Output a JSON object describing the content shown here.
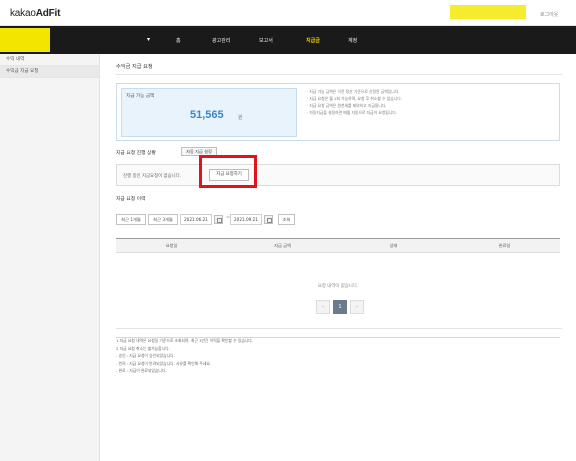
{
  "header": {
    "brand_prefix": "kakao",
    "brand_main": "AdFit",
    "user_label": "로그아웃"
  },
  "nav": {
    "dropdown_icon": "caret-down-icon",
    "items": [
      "홈",
      "광고관리",
      "보고서",
      "지급금",
      "계정"
    ],
    "active_index": 3
  },
  "sidebar": {
    "items": [
      "수익 내역",
      "수익금 지급 요청"
    ]
  },
  "page": {
    "title": "수익금 지급 요청",
    "balance_label": "지급 가능 금액",
    "balance_value": "51,565",
    "balance_unit": "원",
    "notices": [
      "· 지급 가능 금액은 이전 정산 기준으로 산정된 금액입니다.",
      "· 지급 요청은 월 1회 가능하며, 요청 후 취소할 수 없습니다.",
      "· 지급 요청 금액은 원천세를 제외하고 지급됩니다.",
      "· 자동지급을 설정하면 매월 자동으로 지급이 요청됩니다."
    ],
    "status_title": "지급 요청 진행 상황",
    "auto_button": "자동 지급 설정",
    "status_text": "진행 중인 지급요청이 없습니다.",
    "request_button": "지급 요청하기",
    "history_title": "지급 요청 이력",
    "filter_buttons": [
      "최근 1개월",
      "최근 3개월"
    ],
    "date_from": "2021.06.21",
    "date_to": "2021.09.21",
    "date_separator": "~",
    "search_button": "조회",
    "table_headers": [
      "요청일",
      "지급 금액",
      "상태",
      "완료일"
    ],
    "empty_message": "요청 내역이 없습니다.",
    "pager": {
      "prev": "‹",
      "current": "1",
      "next": "›"
    },
    "footnotes": [
      "1  지급 요청 내역은 요청일 기준으로 조회되며, 최근 3년간 이력을 확인할 수 있습니다.",
      "2  지급 요청 취소는 불가능합니다.",
      "- 승인 : 지급 요청이 승인되었습니다.",
      "- 반려 : 지급 요청이 반려되었습니다. 사유를 확인해 주세요.",
      "- 완료 : 지급이 완료되었습니다."
    ]
  }
}
